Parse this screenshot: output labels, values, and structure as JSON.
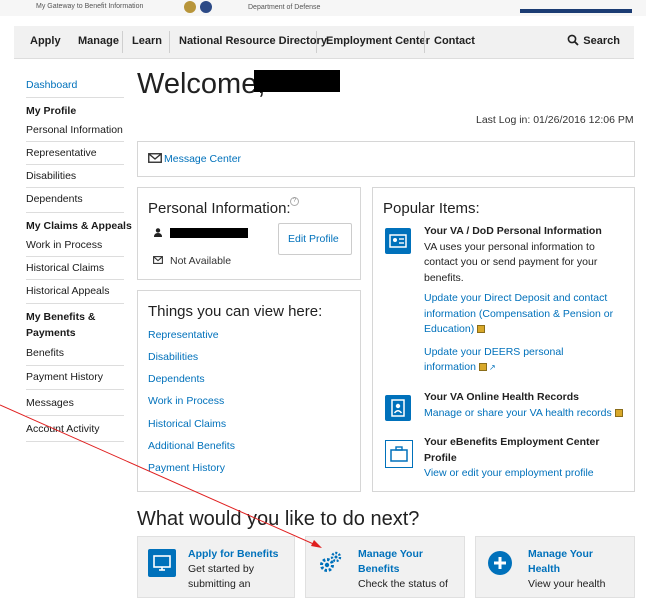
{
  "banner": {
    "tagline": "My Gateway to Benefit Information",
    "department": "Department of Defense"
  },
  "nav": {
    "items": [
      "Apply",
      "Manage",
      "Learn",
      "National Resource Directory",
      "Employment Center",
      "Contact"
    ],
    "search": "Search"
  },
  "sidebar": {
    "dashboard": "Dashboard",
    "profile_heading": "My Profile",
    "profile_items": [
      "Personal Information",
      "Representative",
      "Disabilities",
      "Dependents"
    ],
    "claims_heading": "My Claims & Appeals",
    "claims_items": [
      "Work in Process",
      "Historical Claims",
      "Historical Appeals"
    ],
    "benefits_heading_1": "My Benefits &",
    "benefits_heading_2": "Payments",
    "benefits_items": [
      "Benefits",
      "Payment History"
    ],
    "messages": "Messages",
    "account_activity": "Account Activity"
  },
  "page": {
    "welcome": "Welcome,",
    "last_login": "Last Log in: 01/26/2016 12:06 PM",
    "message_center": "Message Center"
  },
  "personal_info": {
    "title": "Personal Information:",
    "edit_button": "Edit Profile",
    "email_status": "Not Available"
  },
  "things": {
    "title": "Things you can view here:",
    "links": [
      "Representative",
      "Disabilities",
      "Dependents",
      "Work in Process",
      "Historical Claims",
      "Additional Benefits",
      "Payment History"
    ]
  },
  "popular": {
    "title": "Popular Items:",
    "item1": {
      "title": "Your VA / DoD Personal Information",
      "desc_1": "VA uses your personal information to",
      "desc_2": "contact you or send payment for your",
      "desc_3": "benefits.",
      "link1_1": "Update your Direct Deposit and contact",
      "link1_2": "information (Compensation & Pension or",
      "link1_3": "Education)",
      "link2_1": "Update your DEERS personal",
      "link2_2": "information"
    },
    "item2": {
      "title": "Your VA Online Health Records",
      "link": "Manage or share your VA health records"
    },
    "item3": {
      "title_1": "Your eBenefits Employment Center",
      "title_2": "Profile",
      "link": "View or edit your employment profile"
    }
  },
  "next": {
    "title": "What would you like to do next?",
    "cards": [
      {
        "title_1": "Apply for Benefits",
        "desc_1": "Get started by",
        "desc_2": "submitting an"
      },
      {
        "title_1": "Manage Your",
        "title_2": "Benefits",
        "desc_1": "Check the status of"
      },
      {
        "title_1": "Manage Your",
        "title_2": "Health",
        "desc_1": "View your health"
      }
    ]
  },
  "colors": {
    "link": "#0071bb",
    "annotation_arrow": "#e02020",
    "icon_bg": "#0071bb"
  }
}
